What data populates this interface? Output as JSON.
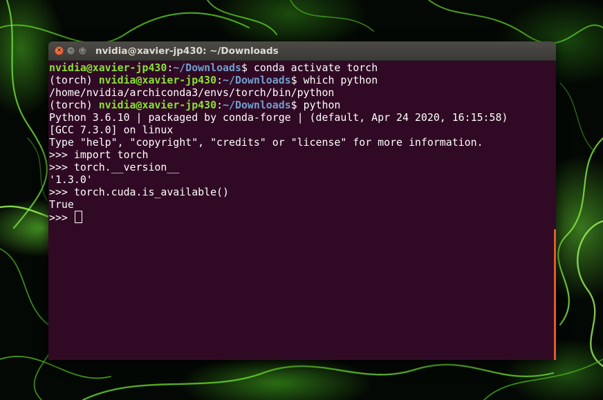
{
  "window": {
    "title": "nvidia@xavier-jp430: ~/Downloads",
    "close_glyph": "×",
    "min_glyph": "–",
    "max_glyph": "□"
  },
  "terminal": {
    "prompt_user": "nvidia@xavier-jp430",
    "prompt_sep": ":",
    "prompt_path": "~/Downloads",
    "prompt_dollar": "$ ",
    "env_prefix": "(torch) ",
    "cmd1": "conda activate torch",
    "cmd2": "which python",
    "out_which": "/home/nvidia/archiconda3/envs/torch/bin/python",
    "cmd3": "python",
    "py_banner1": "Python 3.6.10 | packaged by conda-forge | (default, Apr 24 2020, 16:15:58)",
    "py_banner2": "[GCC 7.3.0] on linux",
    "py_banner3": "Type \"help\", \"copyright\", \"credits\" or \"license\" for more information.",
    "py_in1": ">>> import torch",
    "py_in2": ">>> torch.__version__",
    "py_out2": "'1.3.0'",
    "py_in3": ">>> torch.cuda.is_available()",
    "py_out3": "True",
    "py_prompt": ">>> "
  },
  "colors": {
    "terminal_bg": "#300a24",
    "prompt_user": "#8ae234",
    "prompt_path": "#729fcf",
    "scrollbar": "#e05c2c",
    "close_button": "#e0521f"
  }
}
